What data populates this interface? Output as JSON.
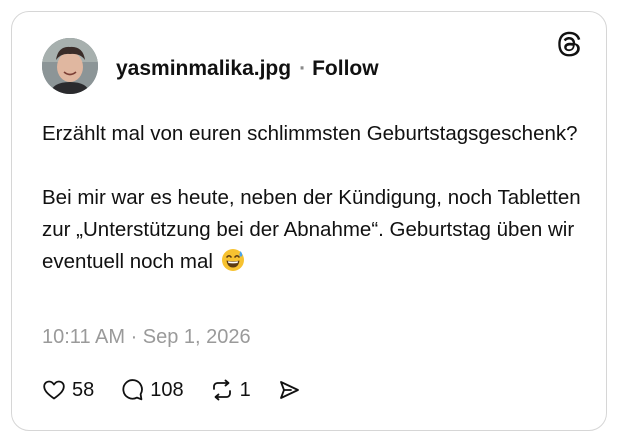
{
  "post": {
    "username": "yasminmalika.jpg",
    "separator": "·",
    "follow_label": "Follow",
    "text_paragraph_1": "Erzählt mal von euren schlimmsten Geburtstagsgeschenk?",
    "text_paragraph_2": "Bei mir war es heute, neben der Kündigung, noch Tabletten zur „Unterstützung bei der Abnahme“. Geburtstag üben wir eventuell noch mal",
    "emoji": "grinning-face-with-sweat",
    "timestamp": "10:11 AM · Sep 1, 2026"
  },
  "actions": {
    "likes": "58",
    "replies": "108",
    "reposts": "1"
  },
  "icons": {
    "brand": "threads-logo-icon",
    "like": "heart-icon",
    "reply": "speech-bubble-icon",
    "repost": "repost-icon",
    "share": "send-icon"
  },
  "colors": {
    "text": "#111111",
    "muted": "#9a9a9a",
    "border": "#d6d6d6"
  }
}
